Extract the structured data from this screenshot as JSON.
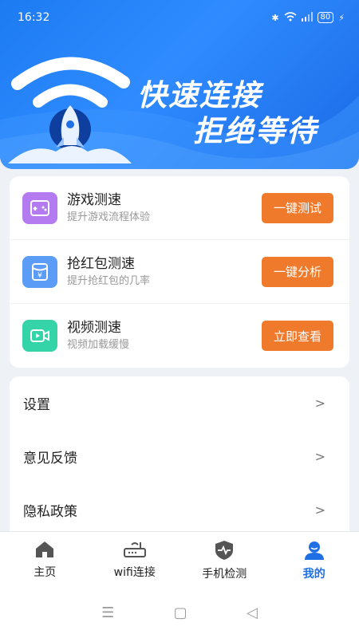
{
  "status_bar": {
    "time": "16:32",
    "battery": "80"
  },
  "banner": {
    "title": "快速连接",
    "subtitle": "拒绝等待"
  },
  "speed_items": [
    {
      "title": "游戏测速",
      "subtitle": "提升游戏流程体验",
      "button": "一键测试",
      "icon": "gamepad-icon",
      "icon_color": "#B37BEF"
    },
    {
      "title": "抢红包测速",
      "subtitle": "提升抢红包的几率",
      "button": "一键分析",
      "icon": "red-packet-icon",
      "icon_color": "#5B9DF6"
    },
    {
      "title": "视频测速",
      "subtitle": "视频加载缓慢",
      "button": "立即查看",
      "icon": "video-icon",
      "icon_color": "#34D3A8"
    }
  ],
  "menu_items": [
    {
      "label": "设置"
    },
    {
      "label": "意见反馈"
    },
    {
      "label": "隐私政策"
    }
  ],
  "tabs": [
    {
      "label": "主页",
      "icon": "home-icon",
      "active": false
    },
    {
      "label": "wifi连接",
      "icon": "router-icon",
      "active": false
    },
    {
      "label": "手机检测",
      "icon": "shield-icon",
      "active": false
    },
    {
      "label": "我的",
      "icon": "profile-icon",
      "active": true
    }
  ],
  "colors": {
    "accent": "#1F6FE5",
    "button": "#F07A2C",
    "banner": "#2F8BFF"
  }
}
